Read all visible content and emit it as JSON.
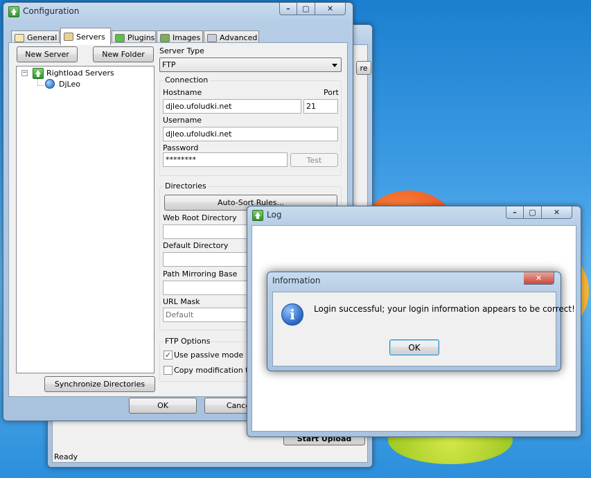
{
  "config_window": {
    "title": "Configuration",
    "tabs": [
      {
        "label": "General"
      },
      {
        "label": "Servers"
      },
      {
        "label": "Plugins"
      },
      {
        "label": "Images"
      },
      {
        "label": "Advanced"
      }
    ],
    "new_server_label": "New Server",
    "new_folder_label": "New Folder",
    "tree_root": "Rightload Servers",
    "tree_child": "DjLeo",
    "sync_label": "Synchronize Directories",
    "server_type_label": "Server Type",
    "server_type_value": "FTP",
    "connection": {
      "title": "Connection",
      "hostname_label": "Hostname",
      "hostname_value": "djleo.ufoludki.net",
      "port_label": "Port",
      "port_value": "21",
      "username_label": "Username",
      "username_value": "djleo.ufoludki.net",
      "password_label": "Password",
      "password_value": "********",
      "test_label": "Test"
    },
    "directories": {
      "title": "Directories",
      "auto_sort_label": "Auto-Sort Rules...",
      "web_root_label": "Web Root Directory",
      "default_dir_label": "Default Directory",
      "path_mirroring_label": "Path Mirroring Base",
      "url_mask_label": "URL Mask",
      "url_mask_placeholder": "Default"
    },
    "ftp_options": {
      "title": "FTP Options",
      "passive_label": "Use passive mode",
      "passive_checked": true,
      "copy_time_label": "Copy modification time",
      "copy_time_checked": false
    },
    "ok_label": "OK",
    "cancel_label": "Cance"
  },
  "main_window": {
    "partial_button_text": "re",
    "start_upload_label": "Start Upload",
    "status_text": "Ready"
  },
  "log_window": {
    "title": "Log"
  },
  "info_dialog": {
    "title": "Information",
    "message": "Login successful; your login information appears to be correct!",
    "ok_label": "OK",
    "icon": "info-icon"
  },
  "colors": {
    "desktop": "#3d9be3",
    "aero_frame": "#b6cde6",
    "info_icon": "#2a66c0"
  }
}
